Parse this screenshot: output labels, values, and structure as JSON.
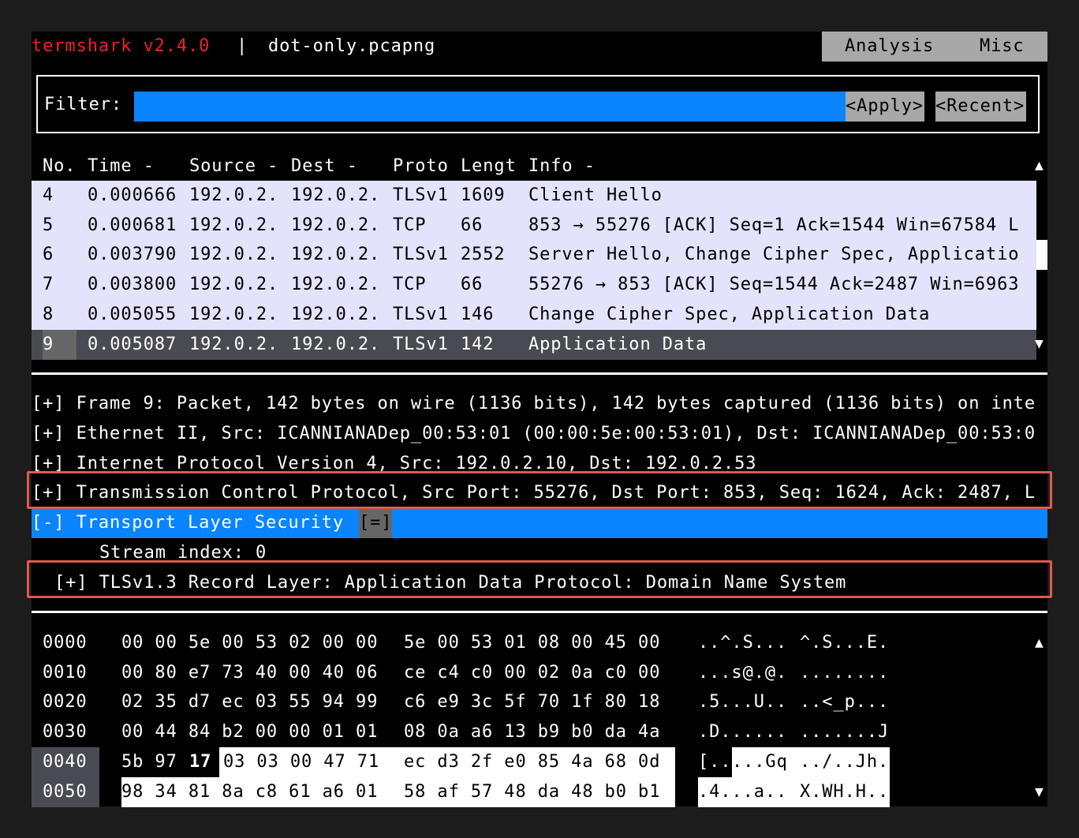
{
  "title": {
    "app": "termshark v2.4.0",
    "separator": "|",
    "file": "dot-only.pcapng"
  },
  "menu": {
    "analysis": "Analysis",
    "misc": "Misc"
  },
  "filter": {
    "label": "Filter:",
    "value": "",
    "apply": "<Apply>",
    "recent": "<Recent>"
  },
  "columns": {
    "no": "No.",
    "time": "Time -",
    "source": "Source -",
    "dest": "Dest -",
    "proto": "Proto",
    "length": "Lengt",
    "info": "Info -"
  },
  "packets": [
    {
      "no": "4",
      "time": "0.000666",
      "source": "192.0.2.",
      "dest": "192.0.2.",
      "proto": "TLSv1",
      "length": "1609",
      "info": "Client Hello"
    },
    {
      "no": "5",
      "time": "0.000681",
      "source": "192.0.2.",
      "dest": "192.0.2.",
      "proto": "TCP",
      "length": "66",
      "info": "853 → 55276 [ACK] Seq=1 Ack=1544 Win=67584 L"
    },
    {
      "no": "6",
      "time": "0.003790",
      "source": "192.0.2.",
      "dest": "192.0.2.",
      "proto": "TLSv1",
      "length": "2552",
      "info": "Server Hello, Change Cipher Spec, Applicatio"
    },
    {
      "no": "7",
      "time": "0.003800",
      "source": "192.0.2.",
      "dest": "192.0.2.",
      "proto": "TCP",
      "length": "66",
      "info": "55276 → 853 [ACK] Seq=1544 Ack=2487 Win=6963"
    },
    {
      "no": "8",
      "time": "0.005055",
      "source": "192.0.2.",
      "dest": "192.0.2.",
      "proto": "TLSv1",
      "length": "146",
      "info": "Change Cipher Spec, Application Data"
    },
    {
      "no": "9",
      "time": "0.005087",
      "source": "192.0.2.",
      "dest": "192.0.2.",
      "proto": "TLSv1",
      "length": "142",
      "info": "Application Data"
    }
  ],
  "selected_packet_index": 5,
  "tree": {
    "frame": "[+] Frame 9: Packet, 142 bytes on wire (1136 bits), 142 bytes captured (1136 bits) on inte",
    "ethernet": "[+] Ethernet II, Src: ICANNIANADep_00:53:01 (00:00:5e:00:53:01), Dst: ICANNIANADep_00:53:0",
    "ip": "[+] Internet Protocol Version 4, Src: 192.0.2.10, Dst: 192.0.2.53",
    "tcp": "[+] Transmission Control Protocol, Src Port: 55276, Dst Port: 853, Seq: 1624, Ack: 2487, L",
    "tls": "[-] Transport Layer Security",
    "tls_expand": "[=]",
    "stream": "Stream index: 0",
    "record": "[+] TLSv1.3 Record Layer: Application Data Protocol: Domain Name System"
  },
  "hex": [
    {
      "offset": "0000",
      "bytes1": "00 00 5e 00 53 02 00 00",
      "bytes2": "5e 00 53 01 08 00 45 00",
      "ascii1": "..^.S...",
      "ascii2": "^.S...E."
    },
    {
      "offset": "0010",
      "bytes1": "00 80 e7 73 40 00 40 06",
      "bytes2": "ce c4 c0 00 02 0a c0 00",
      "ascii1": "...s@.@.",
      "ascii2": "........"
    },
    {
      "offset": "0020",
      "bytes1": "02 35 d7 ec 03 55 94 99",
      "bytes2": "c6 e9 3c 5f 70 1f 80 18",
      "ascii1": ".5...U..",
      "ascii2": "..<_p..."
    },
    {
      "offset": "0030",
      "bytes1": "00 44 84 b2 00 00 01 01",
      "bytes2": "08 0a a6 13 b9 b0 da 4a",
      "ascii1": ".D......",
      "ascii2": ".......J"
    },
    {
      "offset": "0040",
      "bytes1a": "5b 97",
      "bytes1b": "17",
      "bytes1c": "03 03 00 47 71",
      "bytes2": "ec d3 2f e0 85 4a 68 0d",
      "ascii1a": "[..",
      "ascii1b": "...Gq",
      "ascii2": "../..Jh."
    },
    {
      "offset": "0050",
      "bytes1": "98 34 81 8a c8 61 a6 01",
      "bytes2": "58 af 57 48 da 48 b0 b1",
      "ascii1": ".4...a..",
      "ascii2": "X.WH.H.."
    }
  ],
  "colors": {
    "accent_blue": "#0a84ff",
    "title_red": "#ee2222",
    "highlight_box": "#e0584e",
    "row_bg": "#e3e3fb",
    "selected_row": "#4a4a52"
  },
  "icons": {
    "scroll_up": "▲",
    "scroll_down": "▼"
  }
}
